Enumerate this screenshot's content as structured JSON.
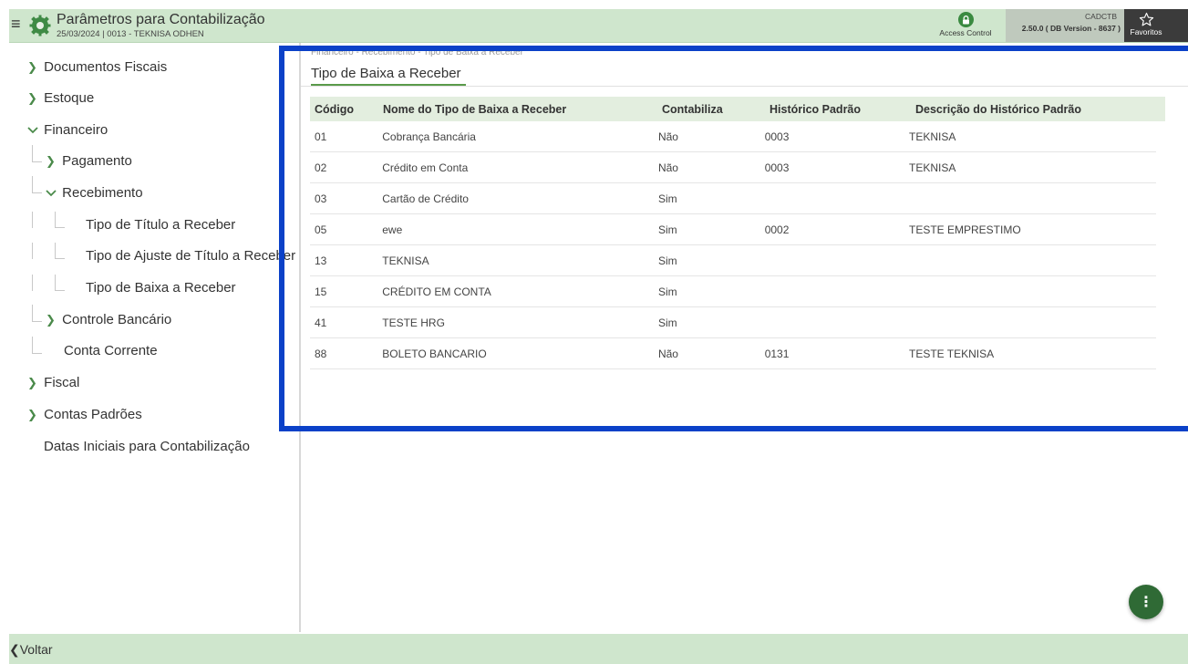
{
  "header": {
    "title": "Parâmetros para Contabilização",
    "subtitle": "25/03/2024 | 0013 - TEKNISA ODHEN",
    "access_control": "Access Control",
    "version_code": "CADCTB",
    "version_text": "2.50.0 ( DB Version - 8637 )",
    "favorites": "Favoritos",
    "menu_glyph": "≡"
  },
  "sidebar": {
    "documentos_fiscais": "Documentos Fiscais",
    "estoque": "Estoque",
    "financeiro": "Financeiro",
    "pagamento": "Pagamento",
    "recebimento": "Recebimento",
    "tipo_titulo": "Tipo de Título a Receber",
    "tipo_ajuste": "Tipo de Ajuste de Título a Receber",
    "tipo_baixa": "Tipo de Baixa a Receber",
    "controle_bancario": "Controle Bancário",
    "conta_corrente": "Conta Corrente",
    "fiscal": "Fiscal",
    "contas_padroes": "Contas Padrões",
    "datas_iniciais": "Datas Iniciais para Contabilização"
  },
  "content": {
    "breadcrumb": "Financeiro - Recebimento - Tipo de Baixa a Receber",
    "title": "Tipo de Baixa a Receber"
  },
  "grid": {
    "headers": [
      "Código",
      "Nome do Tipo de Baixa a Receber",
      "Contabiliza",
      "Histórico Padrão",
      "Descrição do Histórico Padrão"
    ],
    "rows": [
      [
        "01",
        "Cobrança Bancária",
        "Não",
        "0003",
        "TEKNISA"
      ],
      [
        "02",
        "Crédito em Conta",
        "Não",
        "0003",
        "TEKNISA"
      ],
      [
        "03",
        "Cartão de Crédito",
        "Sim",
        "",
        ""
      ],
      [
        "05",
        "ewe",
        "Sim",
        "0002",
        "TESTE EMPRESTIMO"
      ],
      [
        "13",
        "TEKNISA",
        "Sim",
        "",
        ""
      ],
      [
        "15",
        "CRÉDITO EM CONTA",
        "Sim",
        "",
        ""
      ],
      [
        "41",
        "TESTE HRG",
        "Sim",
        "",
        ""
      ],
      [
        "88",
        "BOLETO BANCARIO",
        "Não",
        "0131",
        "TESTE TEKNISA"
      ]
    ]
  },
  "fab_glyph": "⋮",
  "footer": {
    "back_label": "Voltar",
    "back_glyph": "❮"
  },
  "colors": {
    "header_bg": "#cfe6cd",
    "accent": "#2f6a35",
    "highlight": "#0b41c8",
    "grid_header_bg": "#e3eedf"
  },
  "icons": [
    "menu-icon",
    "app-logo-gear-icon",
    "lock-icon",
    "star-icon",
    "chevron-right-icon",
    "chevron-down-icon",
    "more-vertical-icon",
    "chevron-left-icon"
  ]
}
